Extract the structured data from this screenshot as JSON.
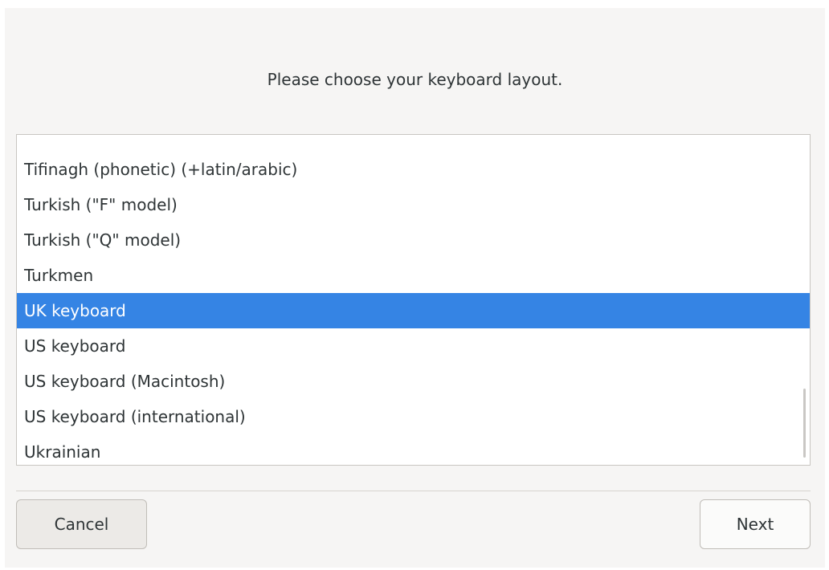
{
  "prompt": "Please choose your keyboard layout.",
  "layouts": [
    "Tifinagh (phonetic) (+latin/arabic)",
    "Turkish (\"F\" model)",
    "Turkish (\"Q\" model)",
    "Turkmen",
    "UK keyboard",
    "US keyboard",
    "US keyboard (Macintosh)",
    "US keyboard (international)",
    "Ukrainian"
  ],
  "selected_layout": "UK keyboard",
  "buttons": {
    "cancel": "Cancel",
    "next": "Next"
  },
  "colors": {
    "selection": "#3584e4",
    "background": "#f6f5f4"
  }
}
